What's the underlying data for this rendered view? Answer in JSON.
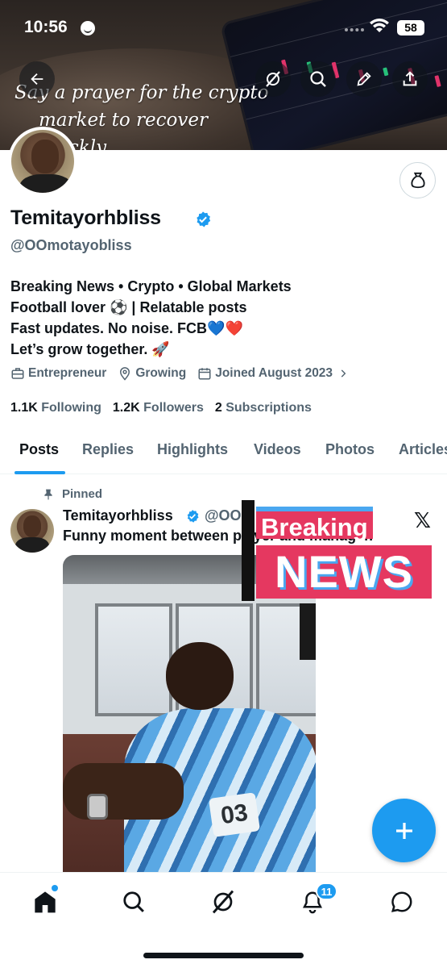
{
  "status_bar": {
    "time": "10:56",
    "battery": "58"
  },
  "banner": {
    "text_line1": "Say a prayer for the crypto",
    "text_line2": "market to recover quickly."
  },
  "profile": {
    "name": "Temitayorhbliss",
    "handle": "@OOmotayobliss",
    "bio": [
      "Breaking News • Crypto • Global Markets",
      "Football lover ⚽ | Relatable posts",
      "Fast updates. No noise. FCB💙❤️",
      "Let’s grow together. 🚀"
    ],
    "meta": {
      "category": "Entrepreneur",
      "location": "Growing",
      "joined": "Joined August 2023"
    },
    "counts": {
      "following_num": "1.1K",
      "following_label": "Following",
      "followers_num": "1.2K",
      "followers_label": "Followers",
      "subscriptions_num": "2",
      "subscriptions_label": "Subscriptions"
    }
  },
  "tabs": [
    "Posts",
    "Replies",
    "Highlights",
    "Videos",
    "Photos",
    "Articles"
  ],
  "post": {
    "pinned_label": "Pinned",
    "author_name": "Temitayorhbliss",
    "author_handle": "@OOmotayobliss",
    "text": "Funny moment between player and manager.",
    "overlay_breaking": "Breaking",
    "overlay_news": "NEWS",
    "overlay_logo": "𝕏",
    "media_jersey_number": "03"
  },
  "bottom_nav": {
    "notifications_badge": "11"
  },
  "colors": {
    "accent": "#1d9bf0",
    "text": "#0f1419",
    "secondary": "#536471",
    "breaking_red": "#e53860"
  }
}
